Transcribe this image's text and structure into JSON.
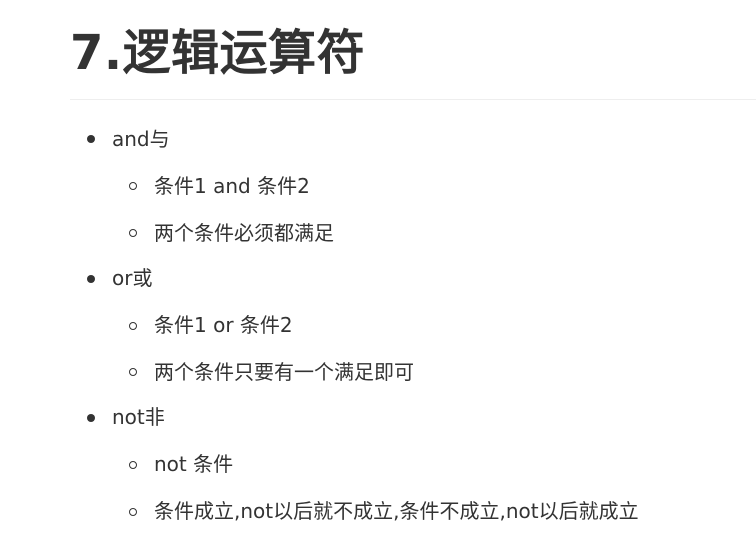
{
  "title": "7.逻辑运算符",
  "items": [
    {
      "label": "and与",
      "children": [
        "条件1 and 条件2",
        "两个条件必须都满足"
      ]
    },
    {
      "label": "or或",
      "children": [
        "条件1 or 条件2",
        "两个条件只要有一个满足即可"
      ]
    },
    {
      "label": "not非",
      "children": [
        "not 条件",
        "条件成立,not以后就不成立,条件不成立,not以后就成立"
      ]
    }
  ]
}
